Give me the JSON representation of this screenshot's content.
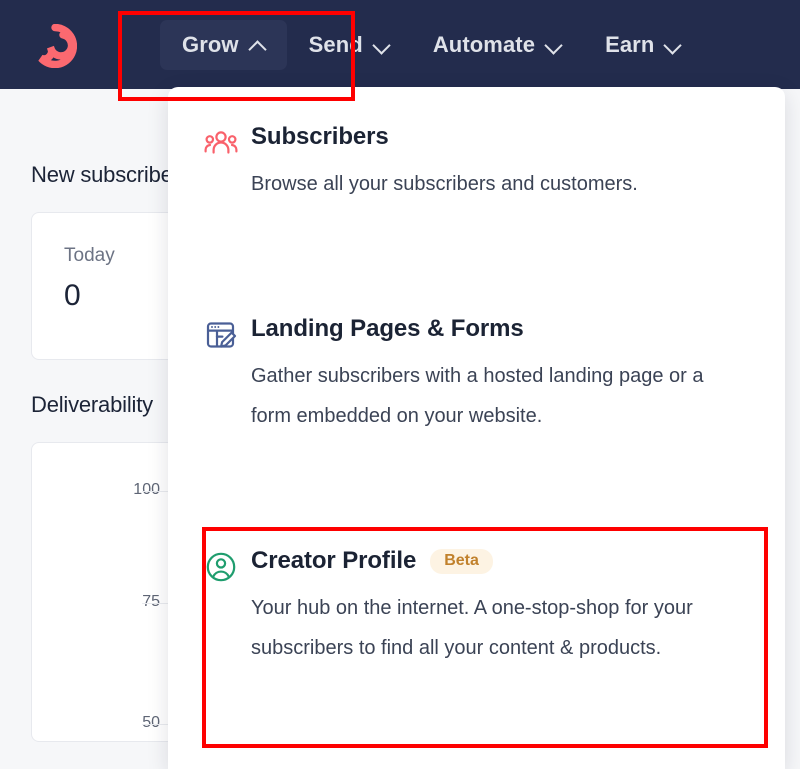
{
  "colors": {
    "navbar_bg": "#232c4d",
    "page_bg": "#f6f7f9",
    "annotation": "#fe0000",
    "logo": "#fb6970",
    "subscribers_icon": "#f9616b",
    "landing_pages_icon": "#4a5f96",
    "creator_profile_icon": "#1f9d6e",
    "badge_text": "#c1812c",
    "badge_bg": "#fdf3e3"
  },
  "navbar": {
    "logo_name": "convertkit-logo",
    "items": [
      {
        "label": "Grow",
        "icon": "chevron-up-icon",
        "active": true
      },
      {
        "label": "Send",
        "icon": "chevron-down-icon",
        "active": false
      },
      {
        "label": "Automate",
        "icon": "chevron-down-icon",
        "active": false
      },
      {
        "label": "Earn",
        "icon": "chevron-down-icon",
        "active": false
      }
    ]
  },
  "dropdown": {
    "open_for": "Grow",
    "items": [
      {
        "title": "Subscribers",
        "description": "Browse all your subscribers and customers.",
        "icon": "people-group-icon",
        "badge": null,
        "highlighted": false
      },
      {
        "title": "Landing Pages & Forms",
        "description": "Gather subscribers with a hosted landing page or a form embedded on your website.",
        "icon": "browser-pencil-icon",
        "badge": null,
        "highlighted": false
      },
      {
        "title": "Creator Profile",
        "description": "Your hub on the internet. A one-stop-shop for your subscribers to find all your content & products.",
        "icon": "user-circle-icon",
        "badge": "Beta",
        "highlighted": true
      }
    ]
  },
  "background": {
    "new_subscribers": {
      "title": "New subscribers",
      "stat_label": "Today",
      "stat_value": "0"
    },
    "deliverability": {
      "title": "Deliverability"
    }
  },
  "chart_data": {
    "type": "line",
    "title": "Deliverability",
    "xlabel": "",
    "ylabel": "",
    "ylim": [
      25,
      100
    ],
    "yticks": [
      100,
      75,
      50
    ],
    "ytick_labels": [
      "100",
      "75",
      "50"
    ],
    "grid": true,
    "legend": null,
    "series": [],
    "categories": []
  },
  "annotations": [
    {
      "name": "grow-nav-highlight",
      "target": "Grow"
    },
    {
      "name": "creator-profile-highlight",
      "target": "Creator Profile"
    }
  ]
}
